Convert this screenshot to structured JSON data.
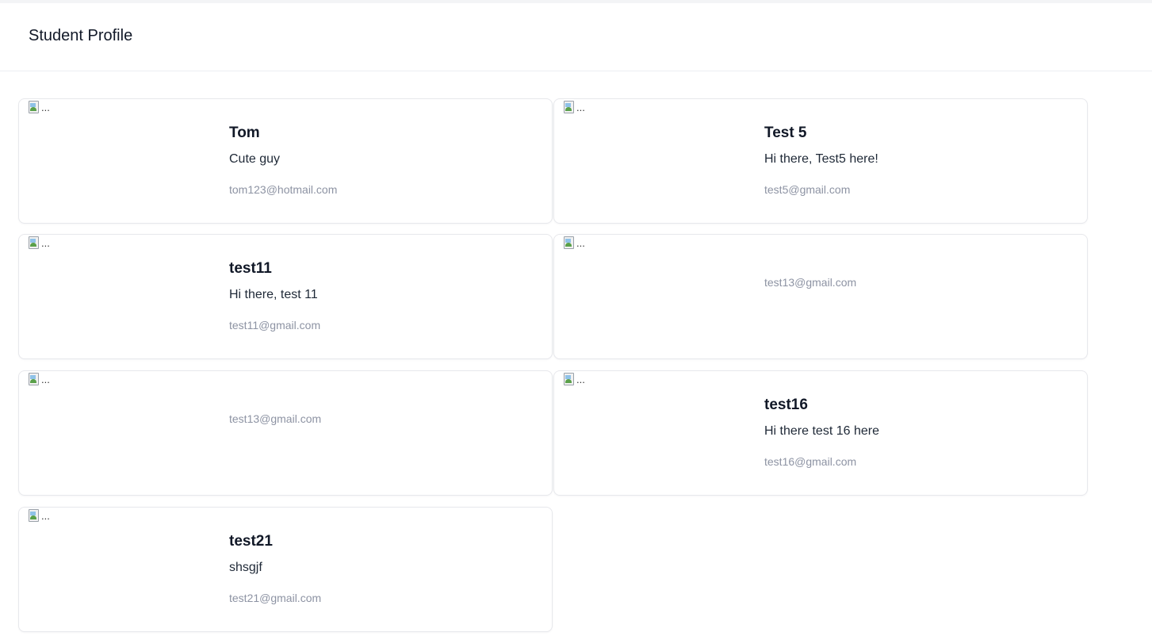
{
  "header": {
    "title": "Student Profile"
  },
  "image_alt": "...",
  "cards": [
    {
      "name": "Tom",
      "bio": "Cute guy",
      "email": "tom123@hotmail.com"
    },
    {
      "name": "Test 5",
      "bio": "Hi there, Test5 here!",
      "email": "test5@gmail.com"
    },
    {
      "name": "test11",
      "bio": "Hi there, test 11",
      "email": "test11@gmail.com"
    },
    {
      "name": "",
      "bio": "",
      "email": "test13@gmail.com"
    },
    {
      "name": "",
      "bio": "",
      "email": "test13@gmail.com"
    },
    {
      "name": "test16",
      "bio": "Hi there test 16 here",
      "email": "test16@gmail.com"
    },
    {
      "name": "test21",
      "bio": "shsgjf",
      "email": "test21@gmail.com"
    }
  ],
  "colors": {
    "title": "#111827",
    "email": "#8d93a3",
    "card_border": "#e7e8ec"
  },
  "icons": {
    "broken_image": "broken-image-icon"
  }
}
